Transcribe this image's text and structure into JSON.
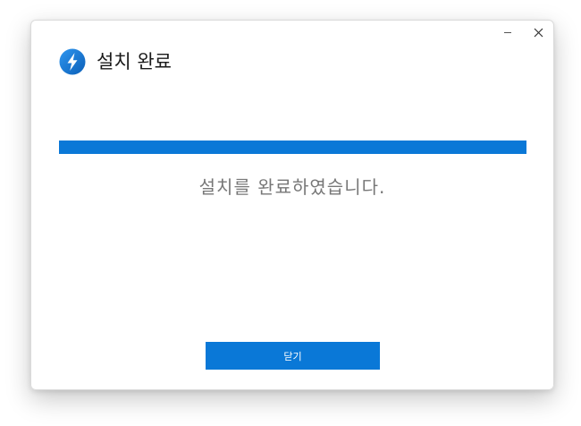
{
  "window": {
    "title": "설치 완료",
    "controls": {
      "minimize_icon": "minimize-icon",
      "close_icon": "close-icon"
    },
    "app_icon": "lightning-bolt-icon"
  },
  "progress": {
    "percent": 100
  },
  "message": "설치를 완료하였습니다.",
  "buttons": {
    "close_label": "닫기"
  },
  "colors": {
    "accent": "#0a78d7",
    "message_text": "#777777",
    "title_text": "#1a1a1a"
  }
}
